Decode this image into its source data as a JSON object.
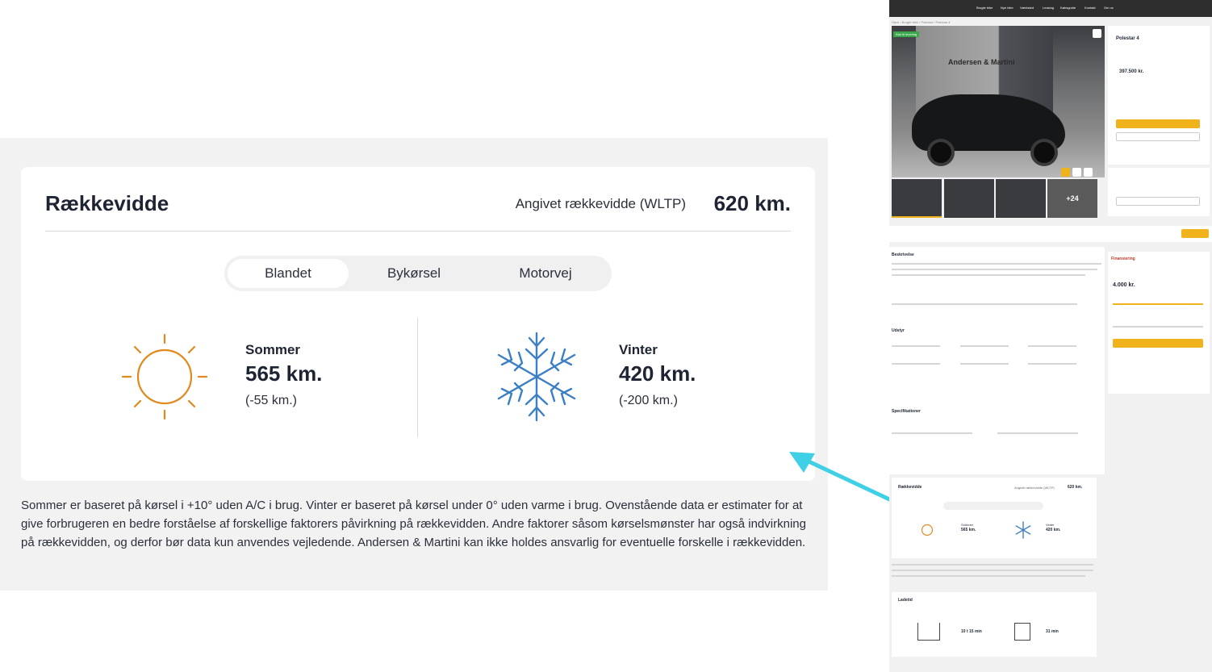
{
  "range": {
    "title": "Rækkevidde",
    "wltp_label": "Angivet rækkevidde (WLTP)",
    "wltp_value": "620 km.",
    "tabs": [
      {
        "label": "Blandet",
        "active": true
      },
      {
        "label": "Bykørsel",
        "active": false
      },
      {
        "label": "Motorvej",
        "active": false
      }
    ],
    "summer": {
      "label": "Sommer",
      "value": "565 km.",
      "diff": "(-55 km.)"
    },
    "winter": {
      "label": "Vinter",
      "value": "420 km.",
      "diff": "(-200 km.)"
    },
    "disclaimer": "Sommer er baseret på kørsel i +10° uden A/C i brug. Vinter er baseret på kørsel under 0° uden varme i brug. Ovenstående data er estimater for at give forbrugeren en bedre forståelse af forskellige faktorers påvirkning på rækkevidden. Andre faktorer såsom kørselsmønster har også indvirkning på rækkevidden, og derfor bør data kun anvendes vejledende. Andersen & Martini kan ikke holdes ansvarlig for eventuelle forskelle i rækkevidden."
  },
  "colors": {
    "sun": "#e08a1e",
    "snow": "#3b7fc4",
    "arrow": "#3fd0e6",
    "accent": "#f1b31c",
    "badge": "#3aa84a"
  },
  "icons": {
    "summer": "sun-icon",
    "winter": "snowflake-icon",
    "pointer": "arrow-icon"
  },
  "mini": {
    "nav": [
      "Brugte biler",
      "Nye biler",
      "Værksted",
      "Leasing",
      "Købsguide",
      "Kontakt",
      "Om os"
    ],
    "breadcrumb": "Hjem / Brugte biler / Polestar / Polestar 4",
    "photo_badge": "Klar til levering",
    "wall_text": "Andersen & Martini",
    "more_photos": "+24",
    "car_title": "Polestar 4",
    "price": "397.500 kr.",
    "sections": {
      "description": "Beskrivelse",
      "equipment": "Udstyr",
      "specs": "Specifikationer",
      "financing": "Finansiering",
      "range": "Rækkevidde",
      "charging": "Ladetid"
    },
    "financing_amount": "4.000 kr.",
    "range_wltp_label": "Angivet rækkevidde (WLTP)",
    "range_wltp": "620 km.",
    "range_summer_label": "Sommer",
    "range_winter_label": "Vinter",
    "range_summer": "565 km.",
    "range_winter": "420 km.",
    "charge_1": "10 t 15 min",
    "charge_2": "31 min",
    "more_photos_count": "+24"
  }
}
